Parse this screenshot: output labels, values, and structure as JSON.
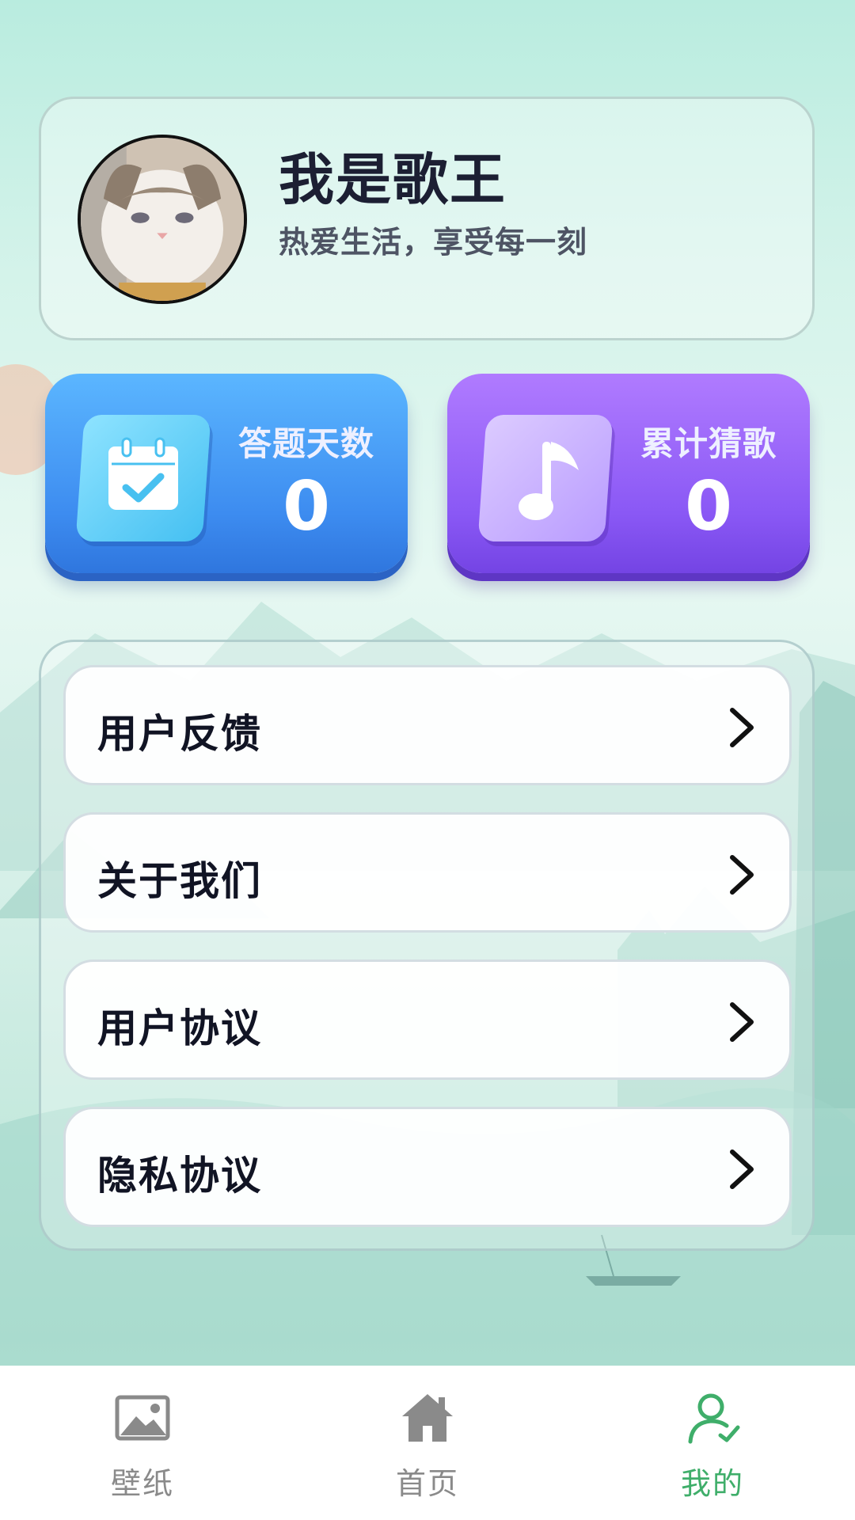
{
  "profile": {
    "username": "我是歌王",
    "motto": "热爱生活，享受每一刻"
  },
  "stats": [
    {
      "label": "答题天数",
      "value": "0",
      "icon": "calendar-check-icon"
    },
    {
      "label": "累计猜歌",
      "value": "0",
      "icon": "music-note-icon"
    }
  ],
  "menu": {
    "items": [
      {
        "label": "用户反馈"
      },
      {
        "label": "关于我们"
      },
      {
        "label": "用户协议"
      },
      {
        "label": "隐私协议"
      }
    ]
  },
  "tabbar": {
    "items": [
      {
        "label": "壁纸",
        "icon": "image-icon",
        "active": false
      },
      {
        "label": "首页",
        "icon": "home-icon",
        "active": false
      },
      {
        "label": "我的",
        "icon": "user-icon",
        "active": true
      }
    ],
    "active_color": "#3fae6a",
    "inactive_color": "#8a8a8a"
  },
  "colors": {
    "stat_blue": "#3d8cf0",
    "stat_purple": "#8a58f5",
    "text_dark": "#1c1f33"
  }
}
